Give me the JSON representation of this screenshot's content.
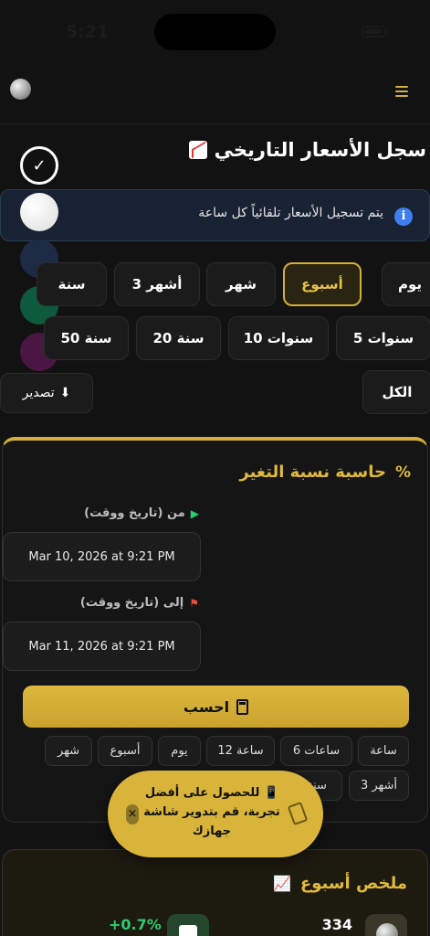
{
  "status_bar": {
    "time": "5:21"
  },
  "header": {
    "logo_icon": "moon-icon",
    "menu_icon": "hamburger-menu-icon"
  },
  "page": {
    "title": "سجل الأسعار التاريخي",
    "title_icon": "chart-increasing-icon"
  },
  "theme_picker": {
    "options": [
      "black",
      "white",
      "navy",
      "green",
      "purple"
    ],
    "selected": "black"
  },
  "info": {
    "text": "يتم تسجيل الأسعار تلقائياً كل ساعة",
    "icon": "info-icon"
  },
  "ranges": {
    "row1": [
      "يوم",
      "أسبوع",
      "شهر",
      "3 أشهر",
      "سنة"
    ],
    "row2": [
      "5 سنوات",
      "10 سنوات",
      "20 سنة",
      "50 سنة"
    ],
    "all": "الكل",
    "active": "أسبوع"
  },
  "export": {
    "label": "تصدير",
    "icon": "download-icon"
  },
  "calculator": {
    "title": "حاسبة نسبة التغير",
    "from_label": "من (تاريخ ووقت)",
    "from_value": "Mar 10, 2026 at 9:21 PM",
    "to_label": "إلى (تاريخ ووقت)",
    "to_value": "Mar 11, 2026 at 9:21 PM",
    "button": "احسب",
    "quick_row1": [
      "ساعة",
      "6 ساعات",
      "12 ساعة",
      "يوم",
      "أسبوع",
      "شهر"
    ],
    "quick_row2": [
      "3 أشهر",
      "سنة"
    ]
  },
  "toast": {
    "text": "📱 للحصول على أفضل تجربة، قم بتدوير شاشة جهازك",
    "close": "×"
  },
  "summary": {
    "title": "ملخص أسبوع",
    "value": "334",
    "change": "+0.7%"
  },
  "colors": {
    "accent": "#d4af37",
    "background": "#121212",
    "positive": "#2ecc71",
    "info": "#3f7ef0"
  }
}
